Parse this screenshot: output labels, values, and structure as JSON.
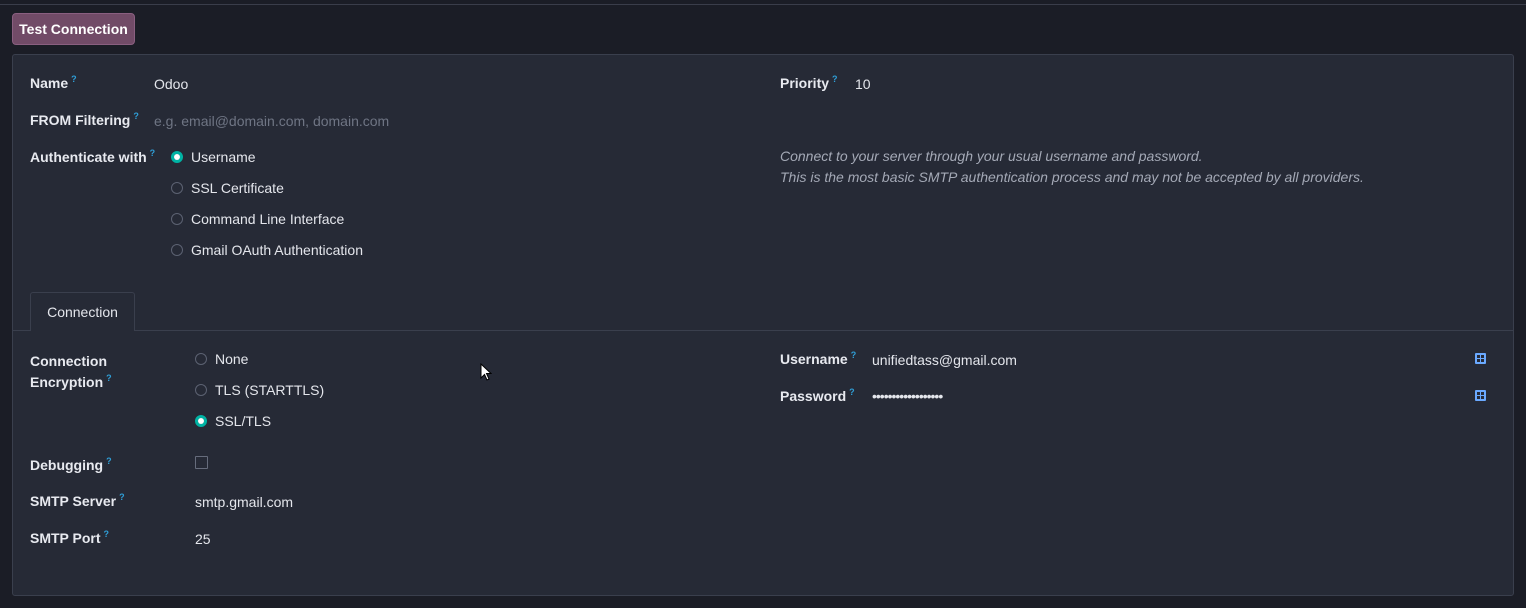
{
  "toolbar": {
    "test_connection_label": "Test Connection"
  },
  "fields": {
    "name": {
      "label": "Name",
      "help": "?",
      "value": "Odoo"
    },
    "priority": {
      "label": "Priority",
      "help": "?",
      "value": "10"
    },
    "from_filtering": {
      "label": "FROM Filtering",
      "help": "?",
      "placeholder": "e.g. email@domain.com, domain.com"
    },
    "authenticate_with": {
      "label": "Authenticate with",
      "help": "?",
      "options": [
        {
          "label": "Username",
          "selected": true
        },
        {
          "label": "SSL Certificate",
          "selected": false
        },
        {
          "label": "Command Line Interface",
          "selected": false
        },
        {
          "label": "Gmail OAuth Authentication",
          "selected": false
        }
      ],
      "hint_lines": [
        "Connect to your server through your usual username and password.",
        "This is the most basic SMTP authentication process and may not be accepted by all providers."
      ]
    }
  },
  "tabs": [
    {
      "label": "Connection",
      "active": true
    }
  ],
  "connection": {
    "encryption": {
      "label_line1": "Connection",
      "label_line2": "Encryption",
      "help": "?",
      "options": [
        {
          "label": "None",
          "selected": false
        },
        {
          "label": "TLS (STARTTLS)",
          "selected": false
        },
        {
          "label": "SSL/TLS",
          "selected": true
        }
      ]
    },
    "debugging": {
      "label": "Debugging",
      "help": "?",
      "checked": false
    },
    "smtp_server": {
      "label": "SMTP Server",
      "help": "?",
      "value": "smtp.gmail.com"
    },
    "smtp_port": {
      "label": "SMTP Port",
      "help": "?",
      "value": "25"
    },
    "username": {
      "label": "Username",
      "help": "?",
      "value": "unifiedtass@gmail.com"
    },
    "password": {
      "label": "Password",
      "help": "?",
      "value": "••••••••••••••••••"
    }
  },
  "colors": {
    "accent": "#714b67",
    "radio_selected": "#00b3a4",
    "help_marker": "#2f9fd8",
    "sheet_bg": "#262a36",
    "page_bg": "#1b1d26"
  },
  "icons": {
    "field_widget": "key-icon"
  }
}
